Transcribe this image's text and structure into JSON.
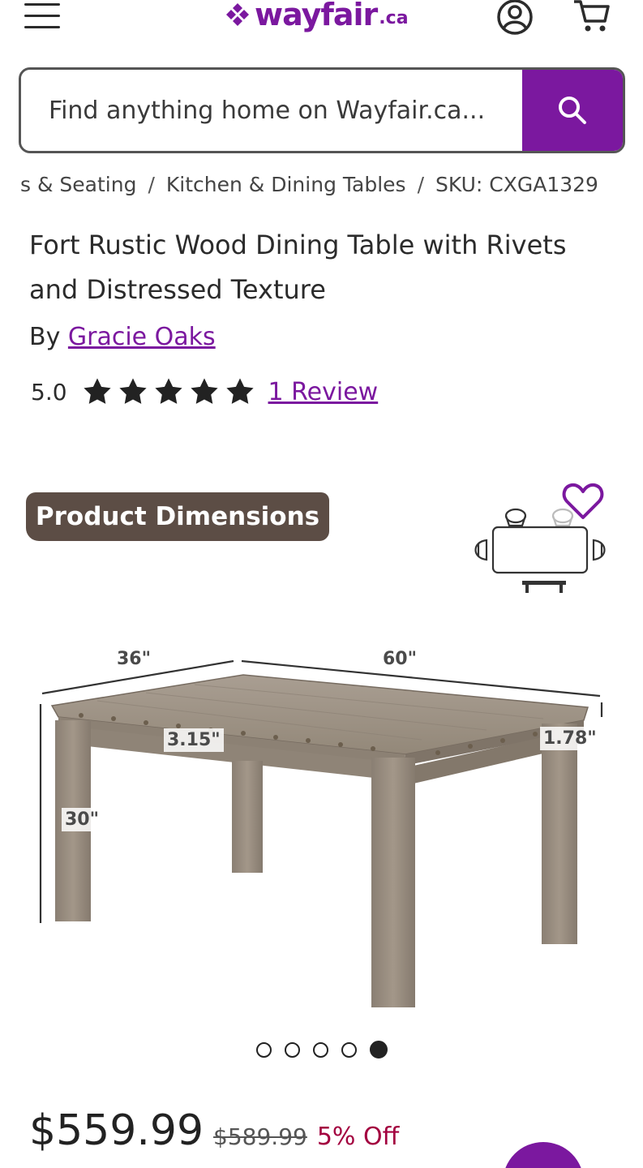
{
  "header": {
    "menu_icon": "hamburger-menu-icon",
    "logo_word": "wayfair",
    "logo_tld": ".ca",
    "brand_color": "#7b189f",
    "account_icon": "account-icon",
    "cart_icon": "cart-icon"
  },
  "search": {
    "placeholder": "Find anything home on Wayfair.ca...",
    "button_icon": "search-icon"
  },
  "breadcrumb": {
    "items": [
      "s & Seating",
      "Kitchen & Dining Tables",
      "SKU: CXGA1329"
    ],
    "separator": "/"
  },
  "product": {
    "title": "Fort Rustic Wood Dining Table with Rivets and Distressed Texture",
    "by_label": "By",
    "brand": "Gracie Oaks",
    "rating_value": "5.0",
    "stars": 5,
    "review_link": "1 Review"
  },
  "image": {
    "badge": "Product Dimensions",
    "wishlist_icon": "heart-icon",
    "dimensions": {
      "depth": "36\"",
      "width": "60\"",
      "apron": "3.15\"",
      "top_thickness": "1.78\"",
      "height": "30\""
    }
  },
  "carousel": {
    "total": 5,
    "active_index": 4
  },
  "pricing": {
    "price": "$559.99",
    "was_price": "$589.99",
    "discount": "5% Off",
    "discount_color": "#a3003f"
  }
}
